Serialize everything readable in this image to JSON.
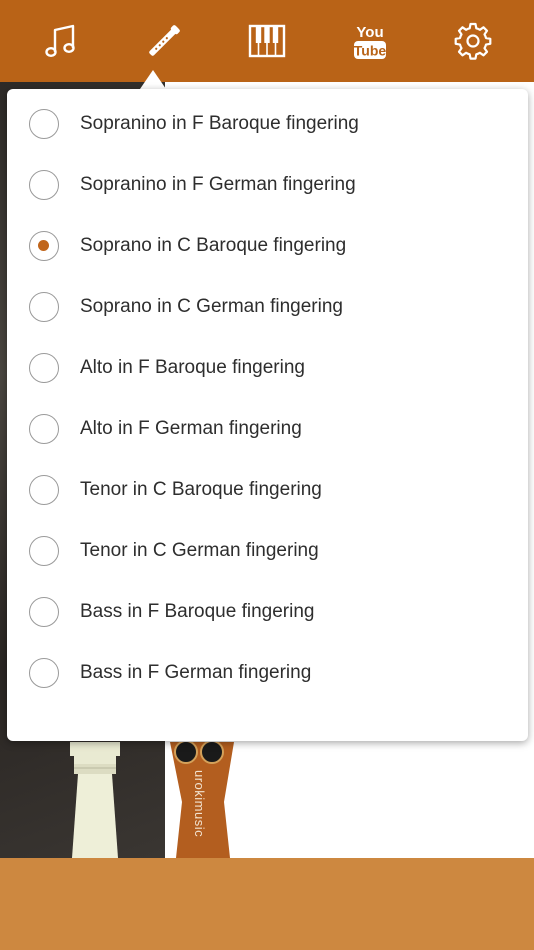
{
  "toolbar": {
    "items": [
      {
        "icon": "music-note-icon",
        "active": false
      },
      {
        "icon": "recorder-flute-icon",
        "active": true
      },
      {
        "icon": "piano-keys-icon",
        "active": false
      },
      {
        "icon": "youtube-icon",
        "active": false,
        "text_top": "You",
        "text_bottom": "Tube"
      },
      {
        "icon": "gear-icon",
        "active": false
      }
    ]
  },
  "background": {
    "watermark": "urokimusic"
  },
  "fingering_menu": {
    "options": [
      {
        "label": "Sopranino in F Baroque fingering",
        "selected": false
      },
      {
        "label": "Sopranino in F German fingering",
        "selected": false
      },
      {
        "label": "Soprano in C Baroque fingering",
        "selected": true
      },
      {
        "label": "Soprano in C German fingering",
        "selected": false
      },
      {
        "label": "Alto in F Baroque fingering",
        "selected": false
      },
      {
        "label": "Alto in F German fingering",
        "selected": false
      },
      {
        "label": "Tenor in C Baroque fingering",
        "selected": false
      },
      {
        "label": "Tenor in C German fingering",
        "selected": false
      },
      {
        "label": "Bass in F Baroque fingering",
        "selected": false
      },
      {
        "label": "Bass in F German fingering",
        "selected": false
      }
    ]
  },
  "colors": {
    "toolbar": "#b96317",
    "bottom_bar": "#cd8840",
    "accent": "#c0651b"
  }
}
